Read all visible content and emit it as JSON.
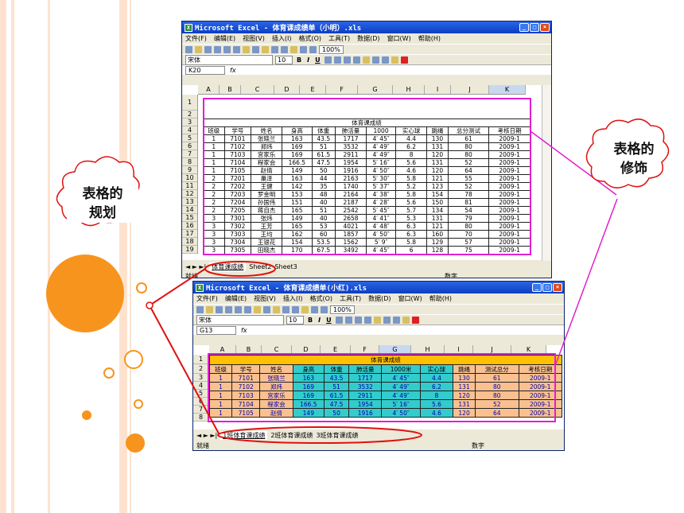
{
  "colors": {
    "accent": "#f7941d",
    "pink": "#e020d0",
    "red": "#e01010",
    "yellow": "#ffc000",
    "teal": "#33cccc",
    "peach": "#fac090",
    "stripe": "#fde3cf"
  },
  "callouts": {
    "left": [
      "表格的",
      "规划"
    ],
    "right": [
      "表格的",
      "修饰"
    ]
  },
  "w1": {
    "title": "Microsoft Excel - 体育课成绩单（小明）.xls",
    "menu": [
      "文件(F)",
      "编辑(E)",
      "视图(V)",
      "插入(I)",
      "格式(O)",
      "工具(T)",
      "数据(D)",
      "窗口(W)",
      "帮助(H)"
    ],
    "font": "宋体",
    "size": "10",
    "zoom": "100%",
    "namebox": "K20",
    "fx": "fx",
    "cols": [
      "A",
      "B",
      "C",
      "D",
      "E",
      "F",
      "G",
      "H",
      "I",
      "J",
      "K"
    ],
    "rows": [
      "1",
      "2",
      "3",
      "4",
      "5",
      "6",
      "7",
      "8",
      "9",
      "10",
      "11",
      "12",
      "13",
      "14",
      "15",
      "16",
      "17",
      "18",
      "19"
    ],
    "sheet_title": "体育课成绩",
    "headers": [
      "班级",
      "学号",
      "姓名",
      "身高",
      "体重",
      "肺活量",
      "1000",
      "实心球",
      "跳绳",
      "总分测试",
      "考核日期"
    ],
    "data": [
      [
        "1",
        "7101",
        "张晓兰",
        "163",
        "43.5",
        "1717",
        "4′ 45″",
        "4.4",
        "130",
        "61",
        "2009-1"
      ],
      [
        "1",
        "7102",
        "郑炜",
        "169",
        "51",
        "3532",
        "4′ 49″",
        "6.2",
        "131",
        "80",
        "2009-1"
      ],
      [
        "1",
        "7103",
        "宫家乐",
        "169",
        "61.5",
        "2911",
        "4′ 49″",
        "8",
        "120",
        "80",
        "2009-1"
      ],
      [
        "1",
        "7104",
        "程家会",
        "166.5",
        "47.5",
        "1954",
        "5′ 16″",
        "5.6",
        "131",
        "52",
        "2009-1"
      ],
      [
        "1",
        "7105",
        "赵倩",
        "149",
        "50",
        "1916",
        "4′ 50″",
        "4.6",
        "120",
        "64",
        "2009-1"
      ],
      [
        "2",
        "7201",
        "巢泽",
        "163",
        "44",
        "2163",
        "5′ 30″",
        "5.8",
        "121",
        "55",
        "2009-1"
      ],
      [
        "2",
        "7202",
        "王健",
        "142",
        "35",
        "1740",
        "5′ 37″",
        "5.2",
        "123",
        "52",
        "2009-1"
      ],
      [
        "2",
        "7203",
        "罗金明",
        "153",
        "48",
        "2164",
        "4′ 38″",
        "5.8",
        "154",
        "78",
        "2009-1"
      ],
      [
        "2",
        "7204",
        "孙国伟",
        "151",
        "40",
        "2187",
        "4′ 28″",
        "5.6",
        "150",
        "81",
        "2009-1"
      ],
      [
        "2",
        "7205",
        "蒋自杰",
        "165",
        "51",
        "2542",
        "5′ 45″",
        "5.7",
        "134",
        "54",
        "2009-1"
      ],
      [
        "3",
        "7301",
        "张炜",
        "149",
        "40",
        "2658",
        "4′ 41″",
        "5.3",
        "131",
        "79",
        "2009-1"
      ],
      [
        "3",
        "7302",
        "王芳",
        "165",
        "53",
        "4021",
        "4′ 48″",
        "6.3",
        "121",
        "80",
        "2009-1"
      ],
      [
        "3",
        "7303",
        "王均",
        "162",
        "60",
        "1857",
        "4′ 50″",
        "6.3",
        "160",
        "70",
        "2009-1"
      ],
      [
        "3",
        "7304",
        "王银花",
        "154",
        "53.5",
        "1562",
        "5′ 9″",
        "5.8",
        "129",
        "57",
        "2009-1"
      ],
      [
        "3",
        "7305",
        "田晓杰",
        "170",
        "67.5",
        "3492",
        "4′ 45″",
        "6",
        "128",
        "75",
        "2009-1"
      ]
    ],
    "tabs": [
      "体育课成绩",
      "Sheet2",
      "Sheet3"
    ],
    "status_left": "就绪",
    "status_right": "数字"
  },
  "w2": {
    "title": "Microsoft Excel - 体育课成绩单(小红).xls",
    "menu": [
      "文件(F)",
      "编辑(E)",
      "视图(V)",
      "插入(I)",
      "格式(O)",
      "工具(T)",
      "数据(D)",
      "窗口(W)",
      "帮助(H)"
    ],
    "font": "宋体",
    "size": "10",
    "zoom": "100%",
    "namebox": "G13",
    "fx": "fx",
    "cols": [
      "A",
      "B",
      "C",
      "D",
      "E",
      "F",
      "G",
      "H",
      "I",
      "J",
      "K"
    ],
    "rows": [
      "1",
      "2",
      "3",
      "4",
      "5",
      "6",
      "7",
      "8"
    ],
    "sheet_title": "体育课成绩",
    "headers": [
      "班级",
      "学号",
      "姓名",
      "身高",
      "体重",
      "肺活量",
      "1000米",
      "实心球",
      "跳绳",
      "测试总分",
      "考核日期"
    ],
    "data": [
      [
        "1",
        "7101",
        "张晓兰",
        "163",
        "43.5",
        "1717",
        "4′ 45″",
        "4.4",
        "130",
        "61",
        "2009-1"
      ],
      [
        "1",
        "7102",
        "郑炜",
        "169",
        "51",
        "3532",
        "4′ 49″",
        "6.2",
        "131",
        "80",
        "2009-1"
      ],
      [
        "1",
        "7103",
        "宫家乐",
        "169",
        "61.5",
        "2911",
        "4′ 49″",
        "8",
        "120",
        "80",
        "2009-1"
      ],
      [
        "1",
        "7104",
        "程家会",
        "166.5",
        "47.5",
        "1954",
        "5′ 16″",
        "5.6",
        "131",
        "52",
        "2009-1"
      ],
      [
        "1",
        "7105",
        "赵倩",
        "149",
        "50",
        "1916",
        "4′ 50″",
        "4.6",
        "120",
        "64",
        "2009-1"
      ]
    ],
    "tabs": [
      "1班体育课成绩",
      "2班体育课成绩",
      "3班体育课成绩"
    ],
    "status_left": "就绪",
    "status_right": "数字"
  }
}
